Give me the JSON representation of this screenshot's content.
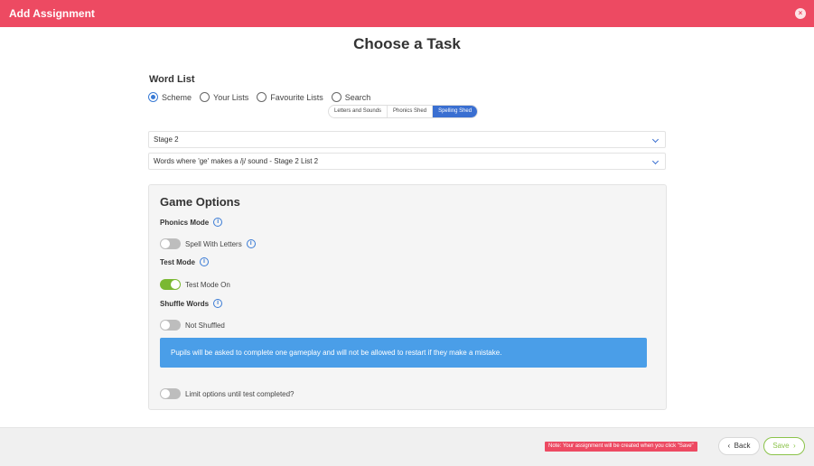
{
  "header": {
    "title": "Add Assignment",
    "close_label": "×"
  },
  "page_title": "Choose a Task",
  "word_list": {
    "label": "Word List",
    "sources": [
      {
        "label": "Scheme",
        "checked": true
      },
      {
        "label": "Your Lists",
        "checked": false
      },
      {
        "label": "Favourite Lists",
        "checked": false
      },
      {
        "label": "Search",
        "checked": false
      }
    ],
    "segments": [
      {
        "label": "Letters and Sounds",
        "active": false
      },
      {
        "label": "Phonics Shed",
        "active": false
      },
      {
        "label": "Spelling Shed",
        "active": true
      }
    ],
    "stage_select": "Stage 2",
    "list_select": "Words where 'ge' makes a /j/ sound - Stage 2 List 2"
  },
  "game_options": {
    "title": "Game Options",
    "phonics_mode_label": "Phonics Mode",
    "phonics_toggle_label": "Spell With Letters",
    "phonics_toggle_on": false,
    "test_mode_label": "Test Mode",
    "test_toggle_label": "Test Mode On",
    "test_toggle_on": true,
    "shuffle_label": "Shuffle Words",
    "shuffle_toggle_label": "Not Shuffled",
    "shuffle_toggle_on": false,
    "info_text": "Pupils will be asked to complete one gameplay and will not be allowed to restart if they make a mistake.",
    "limit_toggle_label": "Limit options until test completed?",
    "limit_toggle_on": false
  },
  "footer": {
    "note": "Note: Your assignment will be created when you click \"Save\"",
    "back_label": "Back",
    "back_icon": "‹",
    "save_label": "Save",
    "save_icon": "›"
  },
  "colors": {
    "brand": "#ed4a62",
    "accent": "#3a6fd1",
    "toggle_on": "#7ab832",
    "info": "#4a9ee8"
  }
}
